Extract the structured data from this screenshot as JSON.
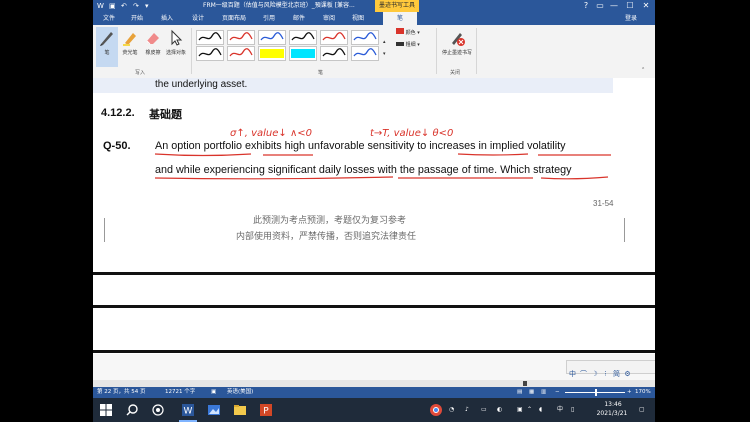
{
  "titlebar": {
    "doc_title": "FRM一级百题（估值与风险模型北京班）_預课板 [兼容...",
    "context_tab": "墨迹书写工具",
    "help": "?",
    "win_min": "—",
    "win_max": "☐",
    "win_close": "✕"
  },
  "tabs": {
    "file": "文件",
    "items": [
      "开始",
      "插入",
      "设计",
      "页面布局",
      "引用",
      "邮件",
      "审阅",
      "视图"
    ],
    "active": "笔",
    "login": "登录"
  },
  "ribbon": {
    "pen_tool": "笔",
    "highlighter": "荧光笔",
    "eraser": "橡皮擦",
    "select_object": "选择对象",
    "write_group": "写入",
    "pens_group": "笔",
    "color": "颜色",
    "thickness": "粗细",
    "stop_inking": "停止墨迹书写",
    "close_group": "关闭",
    "pen_colors": [
      "#111111",
      "#d9342b",
      "#2a5bd7",
      "#111111",
      "#d9342b",
      "#2a5bd7",
      "#111111",
      "#d9342b",
      "#ffff00",
      "#00e5ff",
      "#111111",
      "#2a5bd7",
      "#d9342b",
      "#111111",
      "#00e04a",
      "#00c0ff"
    ]
  },
  "document": {
    "line0": "the underlying asset.",
    "heading_num": "4.12.2.",
    "heading_text": "基础题",
    "q_label": "Q-50.",
    "q_line1": "An option portfolio exhibits high unfavorable sensitivity to increases in implied volatility",
    "q_line2": "and while experiencing significant daily losses with the passage of time. Which strategy",
    "annot1": "σ↑, value↓  ∧<0",
    "annot2": "t→T, value↓  θ<0",
    "page_num": "31-54",
    "wm1": "此预测为考点预测，考题仅为复习参考",
    "wm2": "内部使用资料，严禁传播，否则追究法律责任"
  },
  "ime": [
    "中",
    "⌒",
    "☽",
    "⁝",
    "简",
    "⚙"
  ],
  "statusbar": {
    "page": "第 22 页，共 54 页",
    "words": "12721 个字",
    "lang": "英语(美国)",
    "zoom": "170%"
  },
  "taskbar": {
    "time": "13:46",
    "date": "2021/3/21",
    "ime_label": "中"
  }
}
